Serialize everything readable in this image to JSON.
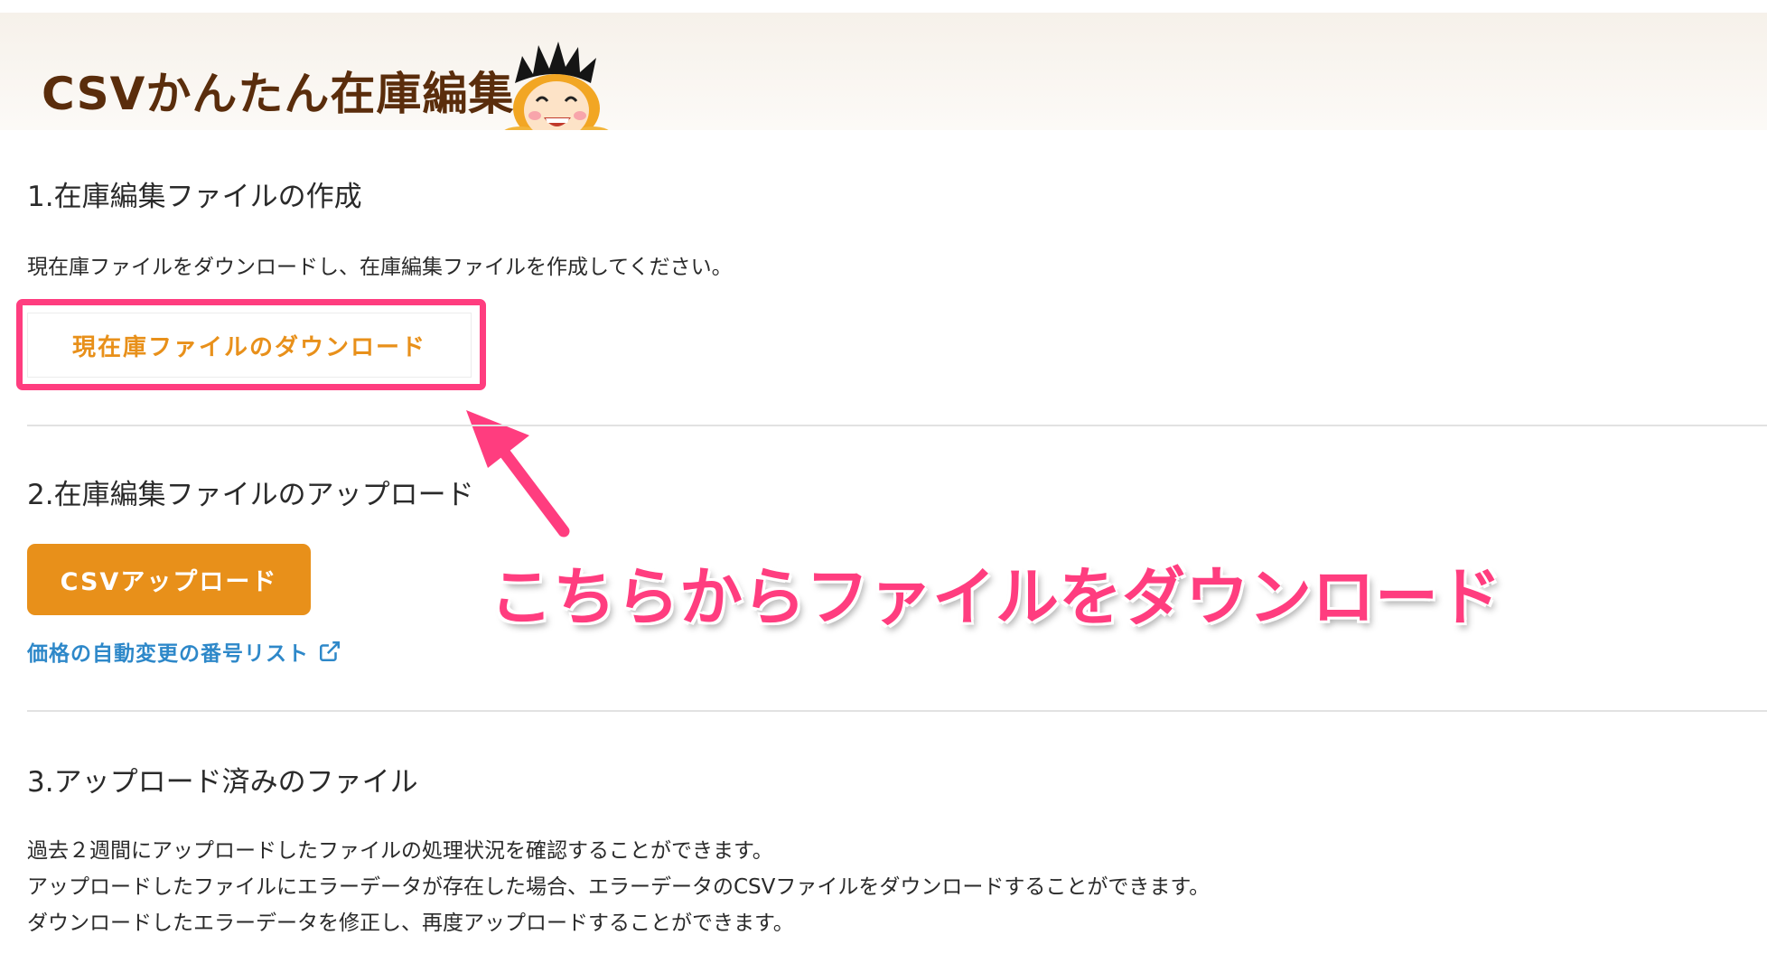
{
  "header": {
    "title": "CSVかんたん在庫編集"
  },
  "section1": {
    "heading": "1.在庫編集ファイルの作成",
    "description": "現在庫ファイルをダウンロードし、在庫編集ファイルを作成してください。",
    "download_button": "現在庫ファイルのダウンロード"
  },
  "section2": {
    "heading": "2.在庫編集ファイルのアップロード",
    "upload_button": "CSVアップロード",
    "link_label": "価格の自動変更の番号リスト",
    "link_icon": "external-link-icon"
  },
  "section3": {
    "heading": "3.アップロード済みのファイル",
    "lines": [
      "過去２週間にアップロードしたファイルの処理状況を確認することができます。",
      "アップロードしたファイルにエラーデータが存在した場合、エラーデータのCSVファイルをダウンロードすることができます。",
      "ダウンロードしたエラーデータを修正し、再度アップロードすることができます。"
    ]
  },
  "annotation": {
    "text": "こちらからファイルをダウンロード"
  },
  "colors": {
    "accent_orange": "#e8901a",
    "title_brown": "#5a2d0c",
    "highlight_pink": "#ff3d7f",
    "link_blue": "#2e88c9"
  }
}
